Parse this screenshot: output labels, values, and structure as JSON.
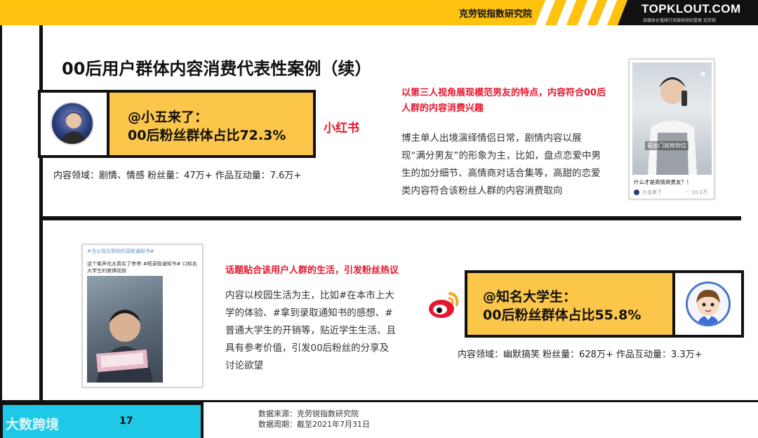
{
  "header": {
    "org": "克劳锐指数研究院",
    "logo": "TOPKLOUT.COM",
    "logo_sub": "自媒体价值排行及版权经纪管理  克劳锐"
  },
  "title": "00后用户群体内容消费代表性案例（续）",
  "case1": {
    "handle": "@小五来了：",
    "ratio": "00后粉丝群体占比72.3%",
    "platform": "小红书",
    "meta": "内容领域：剧情、情感   粉丝量：47万+     作品互动量：7.6万+",
    "highlight": "以第三人视角展现模范男友的特点，内容符合00后人群的内容消费兴趣",
    "description": "博主单人出境演绎情侣日常，剧情内容以展现“满分男友”的形象为主，比如，盘点恋爱中男生的加分细节、高情商对话合集等，高甜的恋爱类内容符合该粉丝人群的内容消费取向",
    "shot": {
      "overlay": "看出门就抢到位",
      "caption": "什么才是高情商男友？！",
      "author": "小五来了",
      "likes": "10.1万"
    }
  },
  "case2": {
    "handle": "@知名大学生：",
    "ratio": "00后粉丝群体占比55.8%",
    "platform": "微博",
    "meta": "内容领域：幽默搞笑     粉丝量：628万+     作品互动量：3.3万+",
    "highlight": "话题贴合该用户人群的生活，引发粉丝热议",
    "description": "内容以校园生活为主，比如#在本市上大学的体验、#拿到录取通知书的感想、#普通大学生的开销等，贴近学生生活、且具有参考价值，引发00后粉丝的分享及讨论欲望",
    "shot": {
      "tag": "#当父母见到你的录取通知书#",
      "line": "这个笑声也太真实了😎😎 #唔录取通知书# 口知名大学生的微博视频"
    }
  },
  "footer": {
    "brand": "大数跨境",
    "page": "17",
    "source": "数据来源：克劳锐指数研究院",
    "period": "数据周期：截至2021年7月31日"
  },
  "colors": {
    "yellow": "#fbc64a",
    "topbar": "#fec20f",
    "red": "#e6162d",
    "cyan": "#1ec8e6"
  }
}
